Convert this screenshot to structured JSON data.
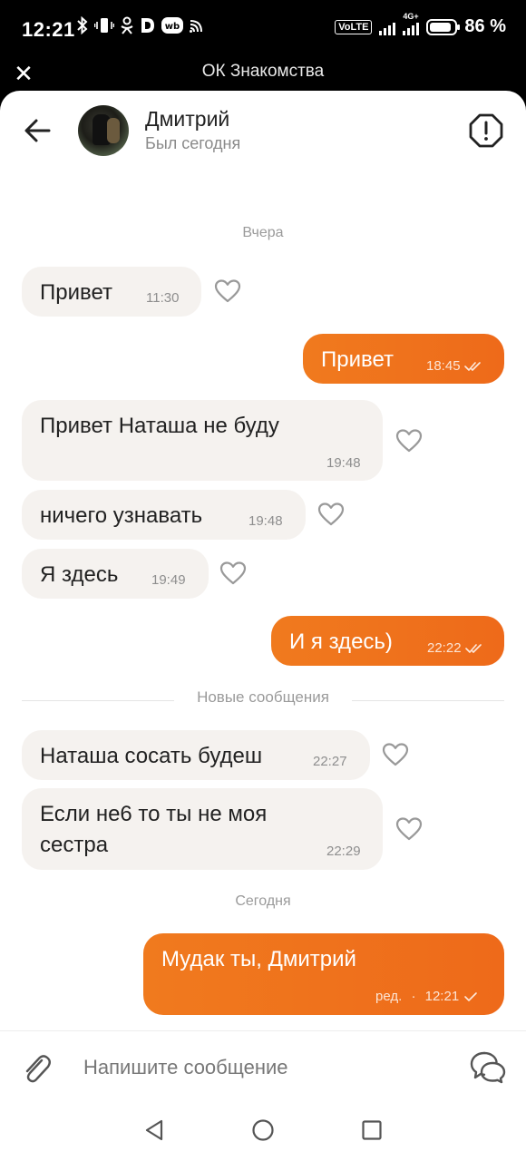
{
  "status_bar": {
    "time": "12:21",
    "left_icons": [
      "bluetooth-icon",
      "vibrate-icon",
      "ok-app-icon",
      "d-app-icon",
      "wb-app-icon",
      "cast-icon"
    ],
    "volte": "VoLTE",
    "network": "4G+",
    "battery": "86 %"
  },
  "title_bar": {
    "close_icon": "close-icon",
    "title": "ОК Знакомства"
  },
  "header": {
    "name": "Дмитрий",
    "status": "Был сегодня"
  },
  "chat": {
    "date_yesterday": "Вчера",
    "new_messages": "Новые сообщения",
    "date_today": "Сегодня",
    "messages": [
      {
        "direction": "in",
        "text": "Привет",
        "time": "11:30"
      },
      {
        "direction": "out",
        "text": "Привет",
        "time": "18:45",
        "status": "read"
      },
      {
        "direction": "in",
        "text": "Привет Наташа не буду",
        "time": "19:48"
      },
      {
        "direction": "in",
        "text": "ничего узнавать",
        "time": "19:48"
      },
      {
        "direction": "in",
        "text": "Я здесь",
        "time": "19:49"
      },
      {
        "direction": "out",
        "text": "И я здесь)",
        "time": "22:22",
        "status": "read"
      },
      {
        "direction": "in",
        "text": "Наташа сосать будеш",
        "time": "22:27"
      },
      {
        "direction": "in",
        "text_line1": "Если не6 то ты не моя",
        "text_line2": "сестра",
        "time": "22:29"
      },
      {
        "direction": "out",
        "text": "Мудак ты, Дмитрий",
        "edited": "ред.",
        "separator": "·",
        "time": "12:21",
        "status": "sent"
      }
    ]
  },
  "input": {
    "placeholder": "Напишите сообщение"
  },
  "colors": {
    "accent": "#ee6a1a",
    "incoming_bubble": "#f5f2ef"
  }
}
